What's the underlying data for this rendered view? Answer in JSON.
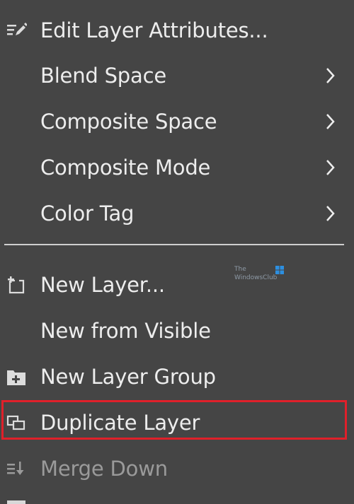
{
  "menu": {
    "items": [
      {
        "label": "Edit Layer Attributes...",
        "icon": "edit-attributes-icon",
        "has_submenu": false,
        "enabled": true
      },
      {
        "label": "Blend Space",
        "icon": "",
        "has_submenu": true,
        "enabled": true
      },
      {
        "label": "Composite Space",
        "icon": "",
        "has_submenu": true,
        "enabled": true
      },
      {
        "label": "Composite Mode",
        "icon": "",
        "has_submenu": true,
        "enabled": true
      },
      {
        "label": "Color Tag",
        "icon": "",
        "has_submenu": true,
        "enabled": true
      },
      {
        "label": "New Layer...",
        "icon": "new-layer-icon",
        "has_submenu": false,
        "enabled": true
      },
      {
        "label": "New from Visible",
        "icon": "",
        "has_submenu": false,
        "enabled": true
      },
      {
        "label": "New Layer Group",
        "icon": "new-layer-group-icon",
        "has_submenu": false,
        "enabled": true
      },
      {
        "label": "Duplicate Layer",
        "icon": "duplicate-layer-icon",
        "has_submenu": false,
        "enabled": true,
        "highlighted": true
      },
      {
        "label": "Merge Down",
        "icon": "merge-down-icon",
        "has_submenu": false,
        "enabled": false
      }
    ]
  },
  "watermark": {
    "line1": "The",
    "line2": "WindowsClub"
  },
  "colors": {
    "background": "#454545",
    "text": "#ededed",
    "disabled_text": "#9a9a9a",
    "highlight_border": "#e0202a"
  }
}
